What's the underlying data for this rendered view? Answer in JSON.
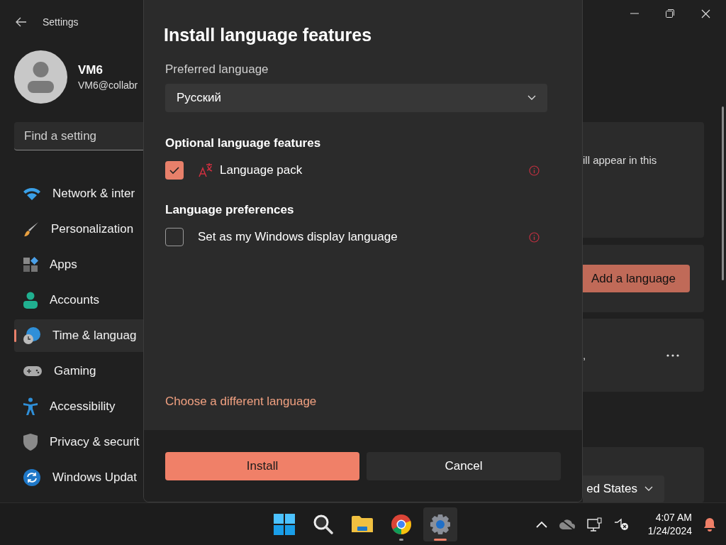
{
  "settings_window": {
    "title": "Settings",
    "user": {
      "name": "VM6",
      "email": "VM6@collabr"
    },
    "search": {
      "placeholder": "Find a setting"
    },
    "nav_items": [
      {
        "label": "Network & inter",
        "selected": false
      },
      {
        "label": "Personalization",
        "selected": false
      },
      {
        "label": "Apps",
        "selected": false
      },
      {
        "label": "Accounts",
        "selected": false
      },
      {
        "label": "Time & languag",
        "selected": true
      },
      {
        "label": "Gaming",
        "selected": false
      },
      {
        "label": "Accessibility",
        "selected": false
      },
      {
        "label": "Privacy & securit",
        "selected": false
      },
      {
        "label": "Windows Updat",
        "selected": false
      }
    ],
    "content": {
      "card_text": "ill appear in this",
      "add_button": "Add a language",
      "language_card_text": ",",
      "region_value": "ed States"
    }
  },
  "dialog": {
    "title": "Install language features",
    "preferred_label": "Preferred language",
    "preferred_value": "Русский",
    "optional_heading": "Optional language features",
    "optional_features": [
      {
        "label": "Language pack",
        "kind": "pack",
        "checked": true
      }
    ],
    "preferences_heading": "Language preferences",
    "preferences": [
      {
        "label": "Set as my Windows display language",
        "kind": "plain",
        "checked": false
      }
    ],
    "link": "Choose a different language",
    "primary_button": "Install",
    "secondary_button": "Cancel"
  },
  "taskbar": {
    "apps": [
      {
        "running": false,
        "selected": false
      },
      {
        "running": false,
        "selected": false
      },
      {
        "running": false,
        "selected": false
      },
      {
        "running": true,
        "selected": false
      },
      {
        "running": true,
        "selected": true
      }
    ],
    "time": "4:07 AM",
    "date": "1/24/2024"
  }
}
